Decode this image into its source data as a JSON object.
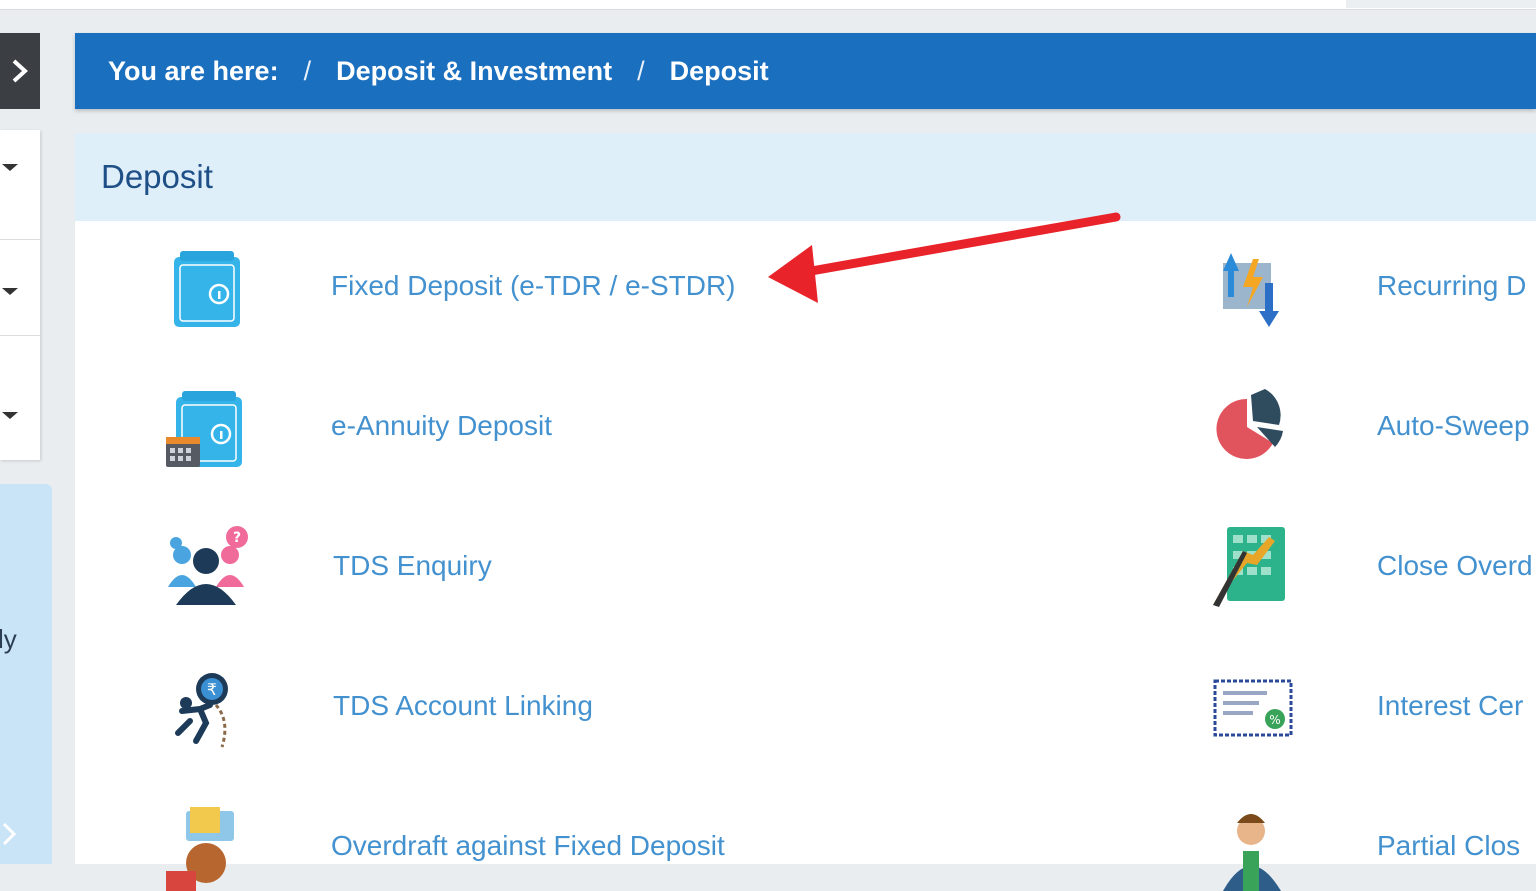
{
  "breadcrumb": {
    "prefix": "You are here:",
    "separator": "/",
    "items": [
      "Deposit & Investment",
      "Deposit"
    ]
  },
  "rail": {
    "partial_text": "ly"
  },
  "section": {
    "title": "Deposit"
  },
  "left_items": [
    {
      "label": "Fixed Deposit (e-TDR / e-STDR)",
      "icon": "safe-icon"
    },
    {
      "label": "e-Annuity Deposit",
      "icon": "safe-calendar-icon"
    },
    {
      "label": "TDS Enquiry",
      "icon": "people-question-icon"
    },
    {
      "label": "TDS Account Linking",
      "icon": "chain-rupee-icon"
    },
    {
      "label": "Overdraft against Fixed Deposit",
      "icon": "money-hand-icon"
    }
  ],
  "right_items": [
    {
      "label": "Recurring D",
      "icon": "arrows-lightning-icon"
    },
    {
      "label": "Auto-Sweep",
      "icon": "pie-chart-icon"
    },
    {
      "label": "Close Overd",
      "icon": "ledger-close-icon"
    },
    {
      "label": "Interest Cer",
      "icon": "certificate-icon"
    },
    {
      "label": "Partial Clos",
      "icon": "person-icon"
    }
  ],
  "colors": {
    "breadcrumb_bg": "#1a6fbf",
    "header_bg": "#deeff9",
    "link": "#4391cf",
    "annotation_arrow": "#e8232a"
  }
}
